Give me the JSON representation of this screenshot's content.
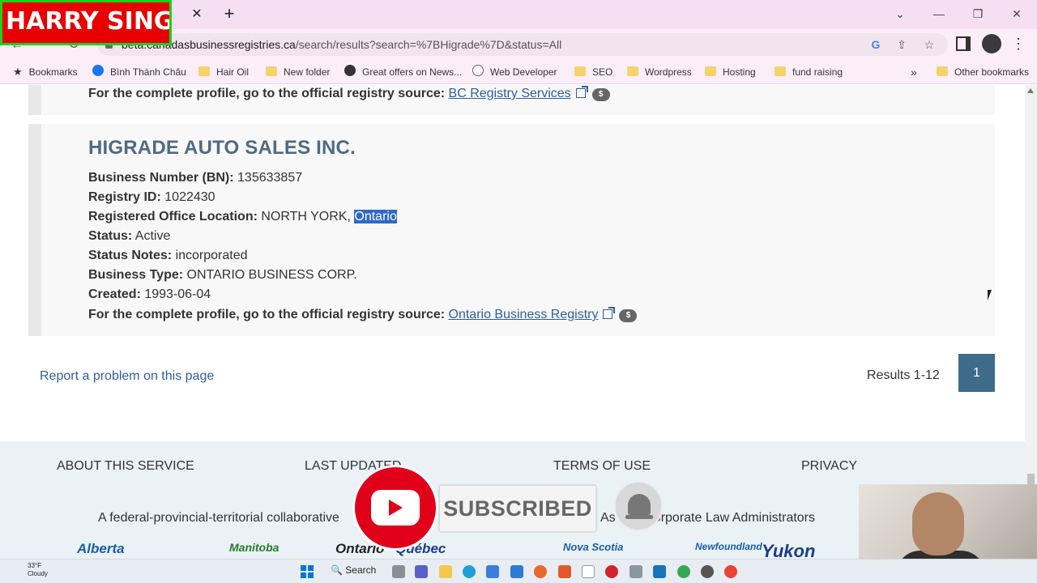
{
  "overlay": {
    "brand_text": "HARRY SINGH",
    "subscribed_label": "SUBSCRIBED"
  },
  "browser": {
    "url_domain": "beta.canadasbusinessregistries.ca",
    "url_path": "/search/results?search=%7BHigrade%7D&status=All",
    "bookmarks": [
      {
        "label": "Bookmarks",
        "icon": "star-icon"
      },
      {
        "label": "Bình Thành Châu",
        "icon": "facebook-icon"
      },
      {
        "label": "Hair Oil",
        "icon": "folder-icon"
      },
      {
        "label": "New folder",
        "icon": "folder-icon"
      },
      {
        "label": "Great offers on News...",
        "icon": "globe-icon"
      },
      {
        "label": "Web Developer",
        "icon": "web-icon"
      },
      {
        "label": "SEO",
        "icon": "folder-icon"
      },
      {
        "label": "Wordpress",
        "icon": "folder-icon"
      },
      {
        "label": "Hosting",
        "icon": "folder-icon"
      },
      {
        "label": "fund raising",
        "icon": "folder-icon"
      }
    ],
    "more_bookmarks": "»",
    "other_bookmarks": "Other bookmarks"
  },
  "prev_result": {
    "profile_label": "For the complete profile, go to the official registry source:",
    "registry_link": "BC Registry Services",
    "badge": "$"
  },
  "result": {
    "name": "HIGRADE AUTO SALES INC.",
    "bn_label": "Business Number (BN):",
    "bn_value": "135633857",
    "registry_label": "Registry ID:",
    "registry_value": "1022430",
    "location_label": "Registered Office Location:",
    "location_city": "NORTH YORK,",
    "location_province": "Ontario",
    "status_label": "Status:",
    "status_value": "Active",
    "notes_label": "Status Notes:",
    "notes_value": "incorporated",
    "type_label": "Business Type:",
    "type_value": "ONTARIO BUSINESS CORP.",
    "created_label": "Created:",
    "created_value": "1993-06-04",
    "profile_label": "For the complete profile, go to the official registry source:",
    "registry_link": "Ontario Business Registry",
    "badge": "$"
  },
  "pagination": {
    "report_link": "Report a problem on this page",
    "results_text": "Results 1-12",
    "page": "1"
  },
  "footer": {
    "links": [
      "ABOUT THIS SERVICE",
      "LAST UPDATED",
      "TERMS OF USE",
      "PRIVACY"
    ],
    "collab_left": "A federal-provincial-territorial collaborative",
    "collab_right": "As        n of Corporate Law Administrators",
    "provinces": [
      "Alberta",
      "Manitoba",
      "Ontario",
      "Québec",
      "Nova Scotia",
      "Newfoundland",
      "Yukon"
    ]
  },
  "taskbar": {
    "temperature": "33°F",
    "condition": "Cloudy",
    "search_label": "Search"
  }
}
